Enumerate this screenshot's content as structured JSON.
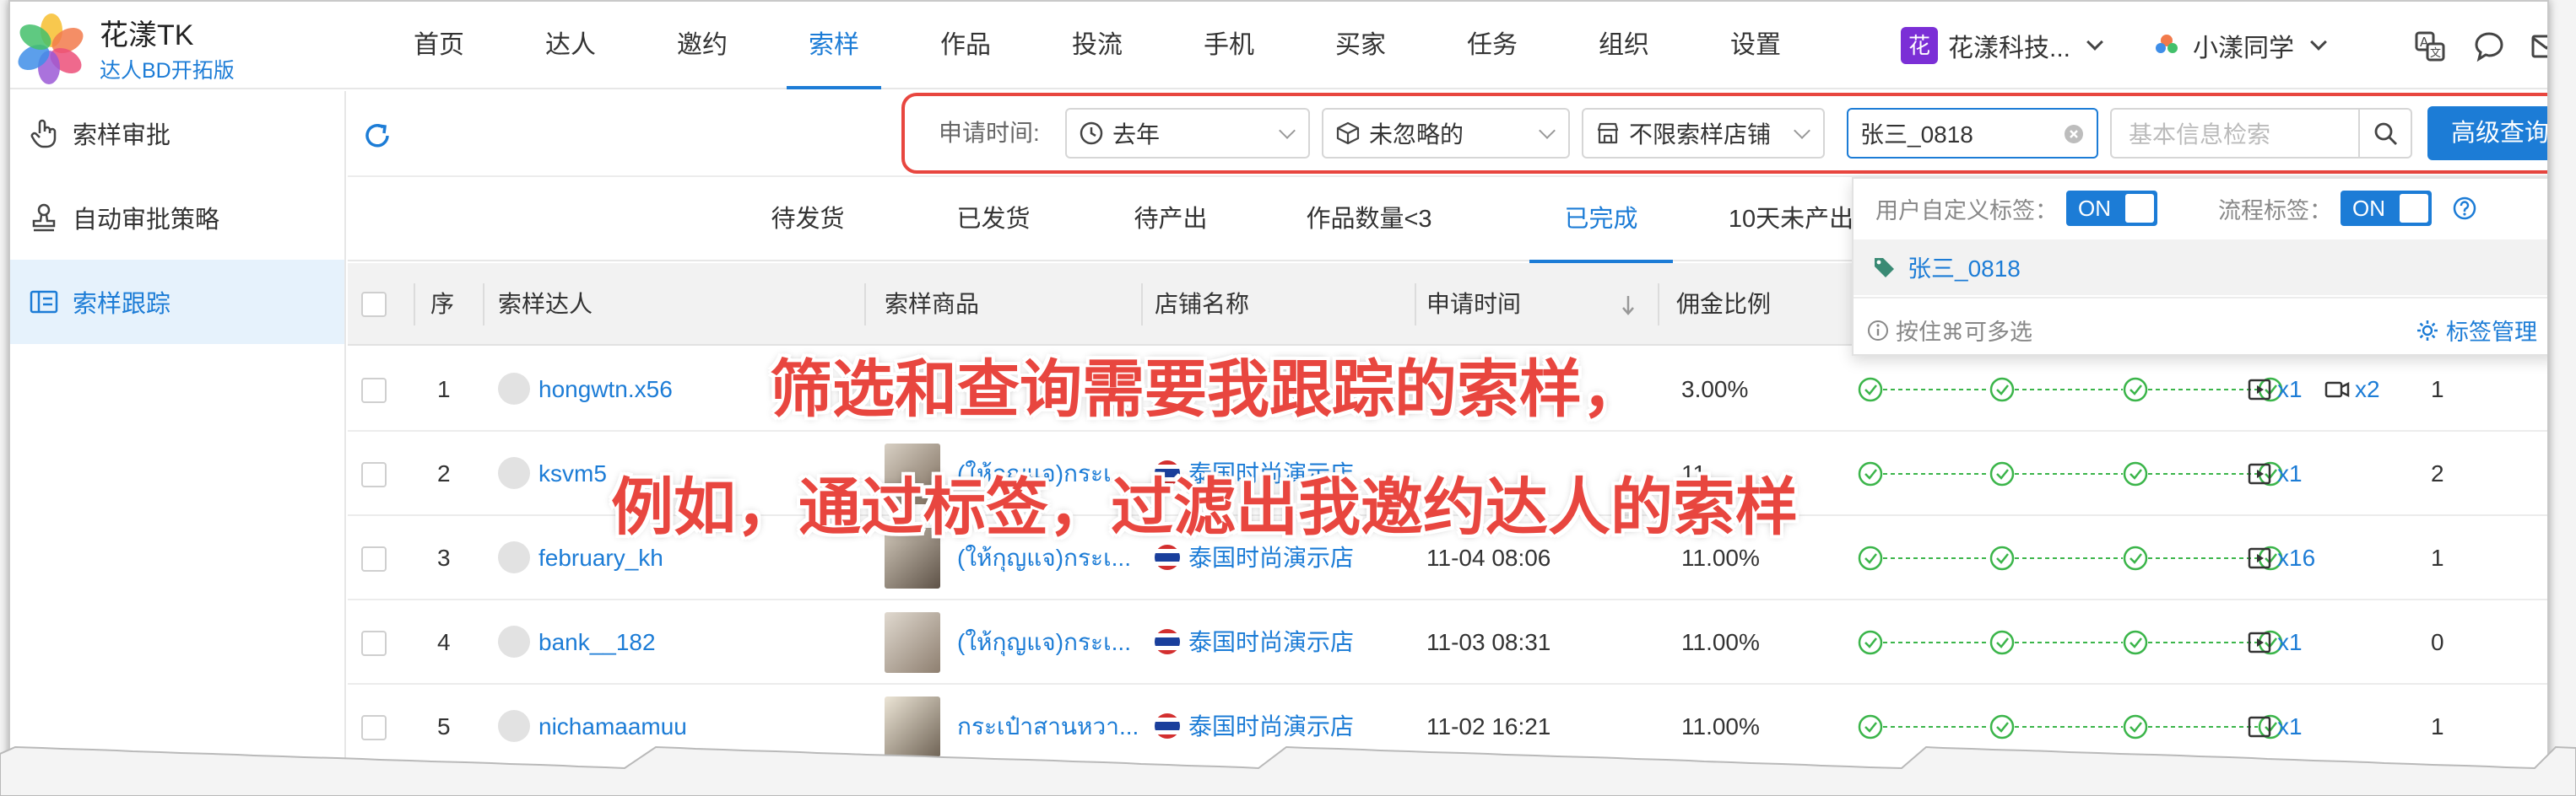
{
  "app": {
    "name": "花漾TK",
    "subtitle": "达人BD开拓版"
  },
  "nav": [
    "首页",
    "达人",
    "邀约",
    "索样",
    "作品",
    "投流",
    "手机",
    "买家",
    "任务",
    "组织",
    "设置"
  ],
  "nav_active": "索样",
  "org_name": "花漾科技...",
  "org_badge": "花",
  "user_name": "小漾同学",
  "sidebar": [
    {
      "label": "索样审批",
      "icon": "hand-pointer-icon"
    },
    {
      "label": "自动审批策略",
      "icon": "stamp-icon"
    },
    {
      "label": "索样跟踪",
      "icon": "card-list-icon",
      "active": true
    }
  ],
  "filters": {
    "time_label": "申请时间:",
    "time_value": "去年",
    "ignore_value": "未忽略的",
    "shop_value": "不限索样店铺",
    "tag_value": "张三_0818",
    "search_placeholder": "基本信息检索",
    "advanced_label": "高级查询"
  },
  "tabs": [
    "待发货",
    "已发货",
    "待产出",
    "作品数量<3",
    "已完成",
    "10天未产出"
  ],
  "tab_active": "已完成",
  "table": {
    "headers": [
      "序",
      "索样达人",
      "索样商品",
      "店铺名称",
      "申请时间",
      "佣金比例"
    ],
    "rows": [
      {
        "no": "1",
        "creator": "hongwtn.x56",
        "product": "",
        "shop": "",
        "time": "",
        "commission": "3.00%",
        "video1": "x1",
        "video2": "x2",
        "count": "1"
      },
      {
        "no": "2",
        "creator": "ksvm5",
        "product": "(ให้กุญแจ)กระเ...",
        "shop": "泰国时尚演示店",
        "time": "",
        "commission": "11.",
        "video1": "x1",
        "video2": "",
        "count": "2"
      },
      {
        "no": "3",
        "creator": "february_kh",
        "product": "(ให้กุญแจ)กระเ...",
        "shop": "泰国时尚演示店",
        "time": "11-04 08:06",
        "commission": "11.00%",
        "video1": "x16",
        "video2": "",
        "count": "1"
      },
      {
        "no": "4",
        "creator": "bank__182",
        "product": "(ให้กุญแจ)กระเ...",
        "shop": "泰国时尚演示店",
        "time": "11-03 08:31",
        "commission": "11.00%",
        "video1": "x1",
        "video2": "",
        "count": "0"
      },
      {
        "no": "5",
        "creator": "nichamaamuu",
        "product": "กระเป๋าสานหวา...",
        "shop": "泰国时尚演示店",
        "time": "11-02 16:21",
        "commission": "11.00%",
        "video1": "x1",
        "video2": "",
        "count": "1"
      }
    ]
  },
  "tag_popover": {
    "custom_label": "用户自定义标签：",
    "custom_switch": "ON",
    "flow_label": "流程标签：",
    "flow_switch": "ON",
    "tag_item": "张三_0818",
    "hint": "按住⌘可多选",
    "manage": "标签管理"
  },
  "annotations": {
    "line1": "筛选和查询需要我跟踪的索样，",
    "line2": "例如，通过标签，过滤出我邀约达人的索样"
  },
  "colors": {
    "accent": "#1c7cd6",
    "annotation": "#e8463f",
    "success": "#3bb54a",
    "org_badge": "#7b2fd6"
  }
}
